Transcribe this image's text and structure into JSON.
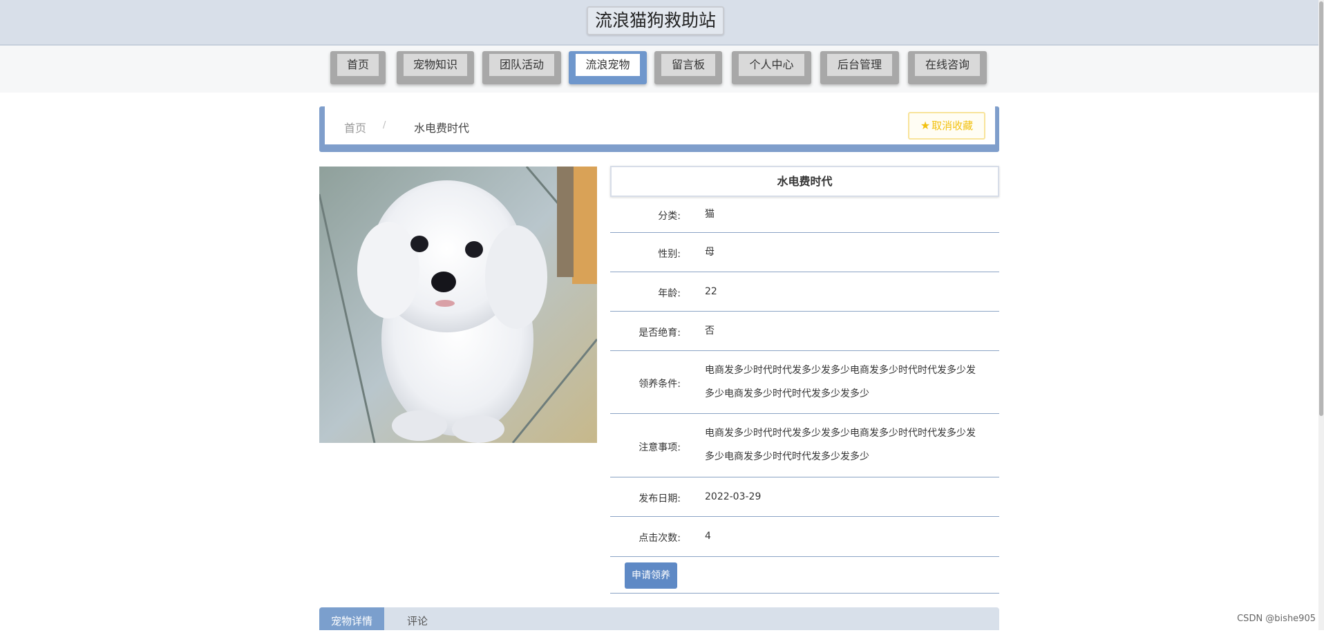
{
  "site": {
    "title": "流浪猫狗救助站"
  },
  "nav": {
    "items": [
      {
        "label": "首页"
      },
      {
        "label": "宠物知识"
      },
      {
        "label": "团队活动"
      },
      {
        "label": "流浪宠物"
      },
      {
        "label": "留言板"
      },
      {
        "label": "个人中心"
      },
      {
        "label": "后台管理"
      },
      {
        "label": "在线咨询"
      }
    ],
    "active": "流浪宠物"
  },
  "breadcrumb": {
    "home": "首页",
    "separator": "/",
    "current": "水电费时代"
  },
  "favorite_button": {
    "label": "取消收藏",
    "icon": "star-icon",
    "color": "#f2c110"
  },
  "photo": {
    "alt": "white poodle dog"
  },
  "detail": {
    "title": "水电费时代",
    "fields": [
      {
        "label": "分类:",
        "value": "猫"
      },
      {
        "label": "性别:",
        "value": "母"
      },
      {
        "label": "年龄:",
        "value": "22"
      },
      {
        "label": "是否绝育:",
        "value": "否"
      },
      {
        "label": "领养条件:",
        "value": "电商发多少时代时代发多少发多少电商发多少时代时代发多少发多少电商发多少时代时代发多少发多少"
      },
      {
        "label": "注意事项:",
        "value": "电商发多少时代时代发多少发多少电商发多少时代时代发多少发多少电商发多少时代时代发多少发多少"
      },
      {
        "label": "发布日期:",
        "value": "2022-03-29"
      },
      {
        "label": "点击次数:",
        "value": "4"
      }
    ],
    "apply_button": "申请领养"
  },
  "tabs": [
    {
      "label": "宠物详情",
      "active": true
    },
    {
      "label": "评论",
      "active": false
    }
  ],
  "watermark": "CSDN @bishe905",
  "colors": {
    "accent": "#7f9ecb",
    "button": "#5e89c5",
    "header": "#d8dfe9"
  }
}
